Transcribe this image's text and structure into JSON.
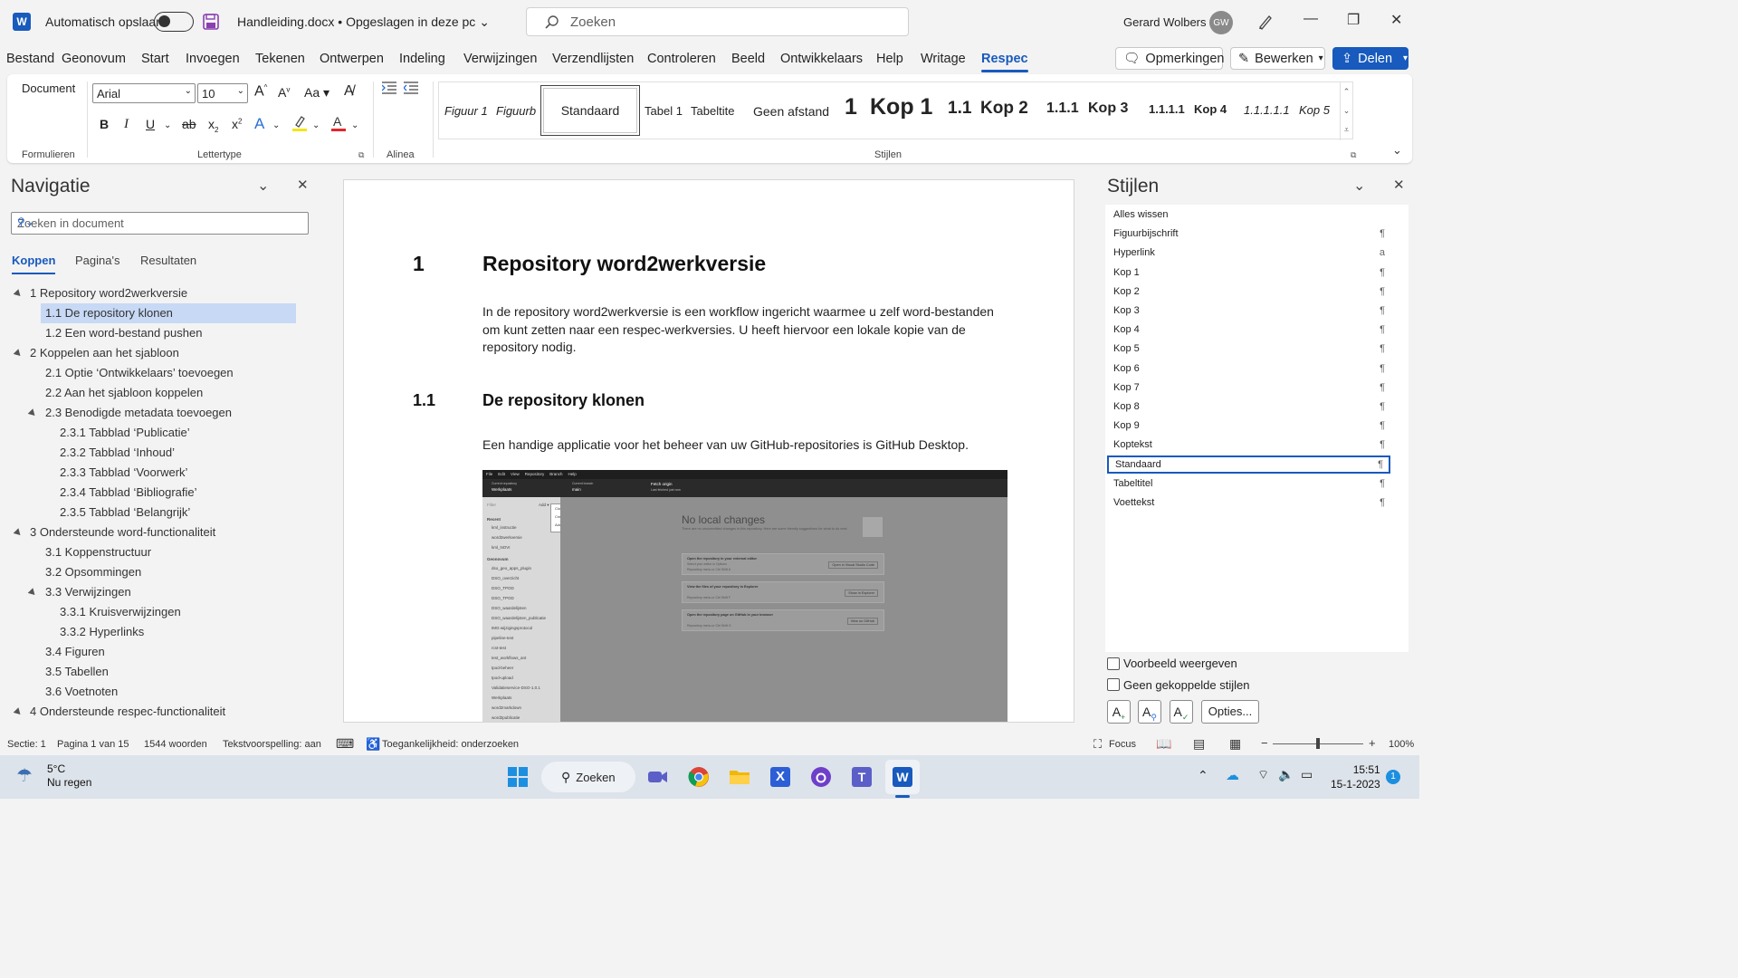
{
  "titlebar": {
    "app_logo": "W",
    "autosave_label": "Automatisch opslaan",
    "doc_title": "Handleiding.docx • Opgeslagen in deze pc",
    "search_placeholder": "Zoeken",
    "user_name": "Gerard Wolbers",
    "user_initials": "GW"
  },
  "menu": {
    "tabs": [
      "Bestand",
      "Geonovum",
      "Start",
      "Invoegen",
      "Tekenen",
      "Ontwerpen",
      "Indeling",
      "Verwijzingen",
      "Verzendlijsten",
      "Controleren",
      "Beeld",
      "Ontwikkelaars",
      "Help",
      "Writage",
      "Respec"
    ],
    "active_tab": "Respec",
    "opmerkingen_label": "Opmerkingen",
    "bewerken_label": "Bewerken",
    "delen_label": "Delen"
  },
  "ribbon": {
    "document_label": "Document",
    "group_formulieren": "Formulieren",
    "font_name": "Arial",
    "font_size": "10",
    "group_lettertype": "Lettertype",
    "group_alinea": "Alinea",
    "group_stijlen": "Stijlen",
    "styles": [
      "Figuur 1",
      "Figuurb",
      "Standaard",
      "Tabel 1",
      "Tabeltite",
      "Geen afstand",
      "1",
      "Kop 1",
      "1.1",
      "Kop 2",
      "1.1.1",
      "Kop 3",
      "1.1.1.1",
      "Kop 4",
      "1.1.1.1.1",
      "Kop 5"
    ]
  },
  "navigation": {
    "title": "Navigatie",
    "search_placeholder": "Zoeken in document",
    "tabs": [
      "Koppen",
      "Pagina's",
      "Resultaten"
    ],
    "active_tab": "Koppen",
    "headings": [
      {
        "text": "1 Repository word2werkversie",
        "level": 1,
        "expanded": true
      },
      {
        "text": "1.1 De repository klonen",
        "level": 2,
        "selected": true
      },
      {
        "text": "1.2 Een word-bestand pushen",
        "level": 2
      },
      {
        "text": "2 Koppelen aan het sjabloon",
        "level": 1,
        "expanded": true
      },
      {
        "text": "2.1 Optie ‘Ontwikkelaars’ toevoegen",
        "level": 2
      },
      {
        "text": "2.2 Aan het sjabloon koppelen",
        "level": 2
      },
      {
        "text": "2.3 Benodigde metadata toevoegen",
        "level": 2,
        "expanded": true
      },
      {
        "text": "2.3.1 Tabblad ‘Publicatie’",
        "level": 3
      },
      {
        "text": "2.3.2 Tabblad ‘Inhoud’",
        "level": 3
      },
      {
        "text": "2.3.3 Tabblad ‘Voorwerk’",
        "level": 3
      },
      {
        "text": "2.3.4 Tabblad ‘Bibliografie’",
        "level": 3
      },
      {
        "text": "2.3.5 Tabblad ‘Belangrijk’",
        "level": 3
      },
      {
        "text": "3 Ondersteunde word-functionaliteit",
        "level": 1,
        "expanded": true
      },
      {
        "text": "3.1 Koppenstructuur",
        "level": 2
      },
      {
        "text": "3.2 Opsommingen",
        "level": 2
      },
      {
        "text": "3.3 Verwijzingen",
        "level": 2,
        "expanded": true
      },
      {
        "text": "3.3.1 Kruisverwijzingen",
        "level": 3
      },
      {
        "text": "3.3.2 Hyperlinks",
        "level": 3
      },
      {
        "text": "3.4 Figuren",
        "level": 2
      },
      {
        "text": "3.5 Tabellen",
        "level": 2
      },
      {
        "text": "3.6 Voetnoten",
        "level": 2
      },
      {
        "text": "4 Ondersteunde respec-functionaliteit",
        "level": 1,
        "expanded": true
      }
    ]
  },
  "document": {
    "h1_number": "1",
    "h1_text": "Repository word2werkversie",
    "p1": "In de repository word2werkversie is een workflow ingericht waarmee u zelf word-bestanden om kunt zetten naar een respec-werkversies. U heeft hiervoor een lokale kopie van de repository nodig.",
    "h2_number": "1.1",
    "h2_text": "De repository klonen",
    "p2": "Een handige applicatie voor het beheer van uw GitHub-repositories is GitHub Desktop.",
    "screenshot": {
      "menus": [
        "File",
        "Edit",
        "View",
        "Repository",
        "Branch",
        "Help"
      ],
      "current_repo_label": "Current repository",
      "current_repo": "Werkplaats",
      "current_branch_label": "Current branch",
      "current_branch": "main",
      "fetch_label": "Fetch origin",
      "fetch_sub": "Last fetched just now",
      "filter": "Filter",
      "add": "Add ▾",
      "add_menu": [
        "Clone repository...",
        "Create new repository...",
        "Add existing repository..."
      ],
      "recent_label": "Recent",
      "recent": [
        "kml_instructie",
        "word2werkversie",
        "kml_NOVI"
      ],
      "group_label": "Geonovum",
      "repos": [
        "dso_geo_apps_plugin",
        "DSO_overzicht",
        "DSO_TPOD",
        "DSO_TPOD",
        "DSO_waardelijsten",
        "DSO_waardelijsten_publicatie",
        "IMG-wijzigingsprotocol",
        "pipeline-test",
        "rcst-test",
        "test_workflows_ant",
        "tpod-beheer",
        "tpod-upload",
        "Validatieservice-DSO-1.0.1",
        "Werkplaats",
        "word2markdown",
        "word2publicatie"
      ],
      "no_local_title": "No local changes",
      "no_local_sub": "There are no uncommitted changes in this repository. Here are some friendly suggestions for what to do next.",
      "cards": [
        {
          "title": "Open the repository in your external editor",
          "sub": "Select your editor in Options",
          "hint": "Repository menu or  Ctrl  Shift  A",
          "btn": "Open in Visual Studio Code"
        },
        {
          "title": "View the files of your repository in Explorer",
          "sub": "",
          "hint": "Repository menu or  Ctrl  Shift  F",
          "btn": "Show in Explorer"
        },
        {
          "title": "Open the repository page on GitHub in your browser",
          "sub": "",
          "hint": "Repository menu or  Ctrl  Shift  G",
          "btn": "View on GitHub"
        }
      ]
    }
  },
  "styles_pane": {
    "title": "Stijlen",
    "items": [
      {
        "name": "Alles wissen",
        "mark": ""
      },
      {
        "name": "Figuurbijschrift",
        "mark": "¶"
      },
      {
        "name": "Hyperlink",
        "mark": "a"
      },
      {
        "name": "Kop 1",
        "mark": "¶"
      },
      {
        "name": "Kop 2",
        "mark": "¶"
      },
      {
        "name": "Kop 3",
        "mark": "¶"
      },
      {
        "name": "Kop 4",
        "mark": "¶"
      },
      {
        "name": "Kop 5",
        "mark": "¶"
      },
      {
        "name": "Kop 6",
        "mark": "¶"
      },
      {
        "name": "Kop 7",
        "mark": "¶"
      },
      {
        "name": "Kop 8",
        "mark": "¶"
      },
      {
        "name": "Kop 9",
        "mark": "¶"
      },
      {
        "name": "Koptekst",
        "mark": "¶"
      },
      {
        "name": "Standaard",
        "mark": "¶",
        "selected": true
      },
      {
        "name": "Tabeltitel",
        "mark": "¶"
      },
      {
        "name": "Voettekst",
        "mark": "¶"
      }
    ],
    "preview_label": "Voorbeeld weergeven",
    "linked_label": "Geen gekoppelde stijlen",
    "options_label": "Opties..."
  },
  "statusbar": {
    "section": "Sectie: 1",
    "page": "Pagina 1 van 15",
    "words": "1544 woorden",
    "prediction": "Tekstvoorspelling: aan",
    "accessibility": "Toegankelijkheid: onderzoeken",
    "focus": "Focus",
    "zoom": "100%"
  },
  "taskbar": {
    "temperature": "5°C",
    "weather": "Nu regen",
    "search_label": "Zoeken",
    "time": "15:51",
    "date": "15-1-2023",
    "notifications": "1"
  },
  "colors": {
    "accent": "#185abd",
    "selection": "#c7d9f5"
  }
}
